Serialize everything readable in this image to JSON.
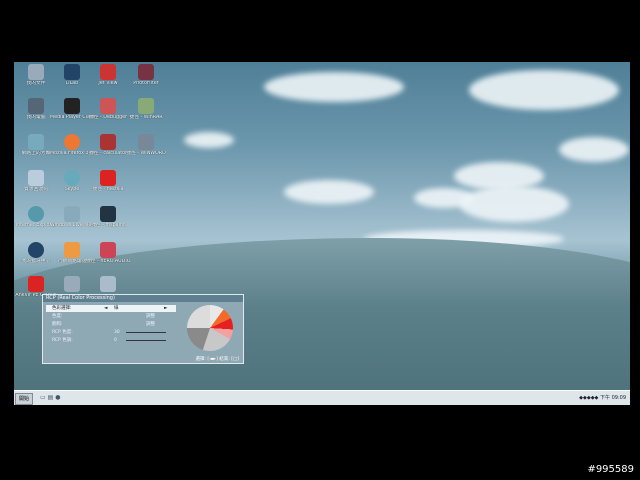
{
  "desktop": {
    "icons": [
      {
        "label": "我的文件",
        "name": "desktop-icon-my-documents"
      },
      {
        "label": "DLab",
        "name": "desktop-icon-dlab"
      },
      {
        "label": "Jet View",
        "name": "desktop-icon-jetview"
      },
      {
        "label": "PhotoFilter",
        "name": "desktop-icon-photofilter"
      },
      {
        "label": "我的電腦",
        "name": "desktop-icon-my-computer"
      },
      {
        "label": "Media Player Classic",
        "name": "desktop-icon-media-player-classic"
      },
      {
        "label": "捷徑 - Debugger",
        "name": "desktop-icon-debugger"
      },
      {
        "label": "捷徑 - WinRAR",
        "name": "desktop-icon-winrar"
      },
      {
        "label": "網路上的芳鄰",
        "name": "desktop-icon-network-places"
      },
      {
        "label": "Mozilla Firefox 3 Beta 4",
        "name": "desktop-icon-firefox"
      },
      {
        "label": "捷徑 - calculator",
        "name": "desktop-icon-calculator"
      },
      {
        "label": "捷徑 - WINWORD",
        "name": "desktop-icon-winword"
      },
      {
        "label": "資源回收筒",
        "name": "desktop-icon-recycle-bin"
      },
      {
        "label": "Skype",
        "name": "desktop-icon-skype"
      },
      {
        "label": "捷徑 - filezilla",
        "name": "desktop-icon-filezilla"
      },
      {
        "label": "Internet Explorer",
        "name": "desktop-icon-internet-explorer"
      },
      {
        "label": "Windows Live Messenger",
        "name": "desktop-icon-messenger"
      },
      {
        "label": "捷徑 - mspaint",
        "name": "desktop-icon-mspaint"
      },
      {
        "label": "我的藍牙中心",
        "name": "desktop-icon-bluetooth"
      },
      {
        "label": "行動網路電話",
        "name": "desktop-icon-net-phone"
      },
      {
        "label": "捷徑 - nERO.AUDIO",
        "name": "desktop-icon-nero-audio"
      },
      {
        "label": "AnkVir PE Classic",
        "name": "desktop-icon-antivirus"
      },
      {
        "label": "",
        "name": "desktop-icon-unlabeled-1"
      },
      {
        "label": "",
        "name": "desktop-icon-unlabeled-2"
      }
    ]
  },
  "rcp": {
    "title": "RCP (Real Color Processing)",
    "rows": [
      {
        "key": "色彩選擇:",
        "value": "綠"
      },
      {
        "key": "色度:",
        "value": "調整"
      },
      {
        "key": "飽和:",
        "value": "調整"
      },
      {
        "key": "RCP 色度:",
        "value": "30"
      },
      {
        "key": "RCP 色調:",
        "value": "0"
      }
    ],
    "footer": "選擇: [◄►] 結束: [□]"
  },
  "taskbar": {
    "start_label": "開始",
    "clock": "下午 09:09"
  },
  "colors": {
    "accent": "#5e7f90",
    "taskbar": "#dfe6ea"
  },
  "watermark": "#995589"
}
